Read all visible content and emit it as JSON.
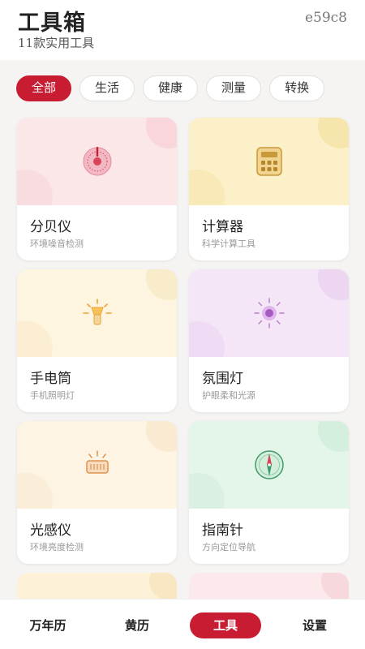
{
  "header": {
    "title": "工具箱",
    "subtitle": "11款实用工具",
    "code": "e59c8"
  },
  "filters": [
    "全部",
    "生活",
    "健康",
    "测量",
    "转换"
  ],
  "tools": [
    {
      "name": "分贝仪",
      "desc": "环境噪音检测",
      "icon": "decibel-icon",
      "bg": "#fbe6e8",
      "accent": "#d9435a"
    },
    {
      "name": "计算器",
      "desc": "科学计算工具",
      "icon": "calculator-icon",
      "bg": "#fbf0c8",
      "accent": "#c99a3c"
    },
    {
      "name": "手电筒",
      "desc": "手机照明灯",
      "icon": "flashlight-icon",
      "bg": "#fdf5e0",
      "accent": "#e8a53a"
    },
    {
      "name": "氛围灯",
      "desc": "护眼柔和光源",
      "icon": "ambient-light-icon",
      "bg": "#f4e6f7",
      "accent": "#a45cc0"
    },
    {
      "name": "光感仪",
      "desc": "环境亮度检测",
      "icon": "light-meter-icon",
      "bg": "#fdf4e3",
      "accent": "#e0934a"
    },
    {
      "name": "指南针",
      "desc": "方向定位导航",
      "icon": "compass-icon",
      "bg": "#e4f5ea",
      "accent": "#3e9a68"
    }
  ],
  "tabbar": [
    "万年历",
    "黄历",
    "工具",
    "设置"
  ],
  "colors": {
    "brand": "#c81c32"
  }
}
